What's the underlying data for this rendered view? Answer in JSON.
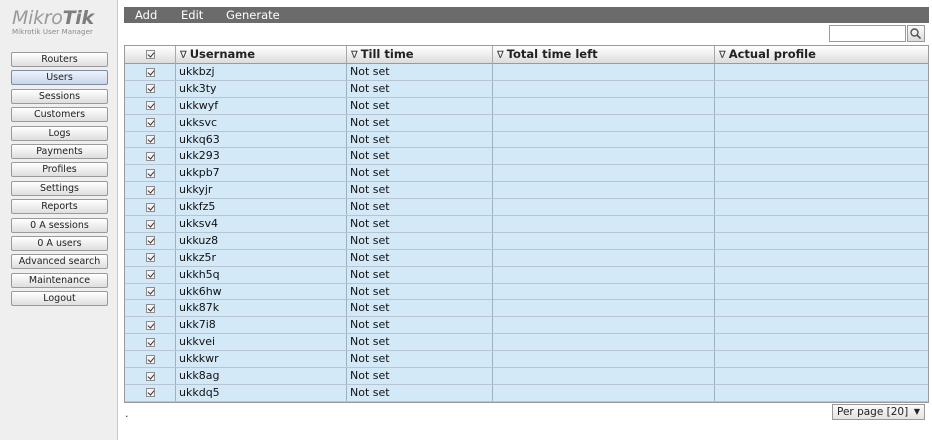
{
  "logo": {
    "brand_light": "Mikro",
    "brand_bold": "Tik",
    "subtitle": "Mikrotik User Manager"
  },
  "sidebar": {
    "items": [
      {
        "label": "Routers",
        "active": false
      },
      {
        "label": "Users",
        "active": true
      },
      {
        "label": "Sessions",
        "active": false
      },
      {
        "label": "Customers",
        "active": false
      },
      {
        "label": "Logs",
        "active": false
      },
      {
        "label": "Payments",
        "active": false
      },
      {
        "label": "Profiles",
        "active": false
      },
      {
        "label": "Settings",
        "active": false
      },
      {
        "label": "Reports",
        "active": false
      },
      {
        "label": "0 A sessions",
        "active": false
      },
      {
        "label": "0 A users",
        "active": false
      },
      {
        "label": "Advanced search",
        "active": false
      },
      {
        "label": "Maintenance",
        "active": false
      },
      {
        "label": "Logout",
        "active": false
      }
    ]
  },
  "menubar": {
    "items": [
      "Add",
      "Edit",
      "Generate"
    ]
  },
  "search": {
    "value": "",
    "placeholder": "",
    "icon": "magnifier-icon"
  },
  "table": {
    "columns": [
      "",
      "Username",
      "Till time",
      "Total time left",
      "Actual profile"
    ],
    "sort_glyph": "∇",
    "rows": [
      {
        "username": "ukkbzj",
        "till": "Not set",
        "left": "",
        "profile": ""
      },
      {
        "username": "ukk3ty",
        "till": "Not set",
        "left": "",
        "profile": ""
      },
      {
        "username": "ukkwyf",
        "till": "Not set",
        "left": "",
        "profile": ""
      },
      {
        "username": "ukksvc",
        "till": "Not set",
        "left": "",
        "profile": ""
      },
      {
        "username": "ukkq63",
        "till": "Not set",
        "left": "",
        "profile": ""
      },
      {
        "username": "ukk293",
        "till": "Not set",
        "left": "",
        "profile": ""
      },
      {
        "username": "ukkpb7",
        "till": "Not set",
        "left": "",
        "profile": ""
      },
      {
        "username": "ukkyjr",
        "till": "Not set",
        "left": "",
        "profile": ""
      },
      {
        "username": "ukkfz5",
        "till": "Not set",
        "left": "",
        "profile": ""
      },
      {
        "username": "ukksv4",
        "till": "Not set",
        "left": "",
        "profile": ""
      },
      {
        "username": "ukkuz8",
        "till": "Not set",
        "left": "",
        "profile": ""
      },
      {
        "username": "ukkz5r",
        "till": "Not set",
        "left": "",
        "profile": ""
      },
      {
        "username": "ukkh5q",
        "till": "Not set",
        "left": "",
        "profile": ""
      },
      {
        "username": "ukk6hw",
        "till": "Not set",
        "left": "",
        "profile": ""
      },
      {
        "username": "ukk87k",
        "till": "Not set",
        "left": "",
        "profile": ""
      },
      {
        "username": "ukk7i8",
        "till": "Not set",
        "left": "",
        "profile": ""
      },
      {
        "username": "ukkvei",
        "till": "Not set",
        "left": "",
        "profile": ""
      },
      {
        "username": "ukkkwr",
        "till": "Not set",
        "left": "",
        "profile": ""
      },
      {
        "username": "ukk8ag",
        "till": "Not set",
        "left": "",
        "profile": ""
      },
      {
        "username": "ukkdq5",
        "till": "Not set",
        "left": "",
        "profile": ""
      }
    ]
  },
  "footer": {
    "dot": ".",
    "per_page": "Per page [20]",
    "per_page_arrow": "▼"
  },
  "colors": {
    "row_bg": "#d4e9f8",
    "menubar_bg": "#6b6b6b",
    "active_nav": "#c9d6ea"
  }
}
